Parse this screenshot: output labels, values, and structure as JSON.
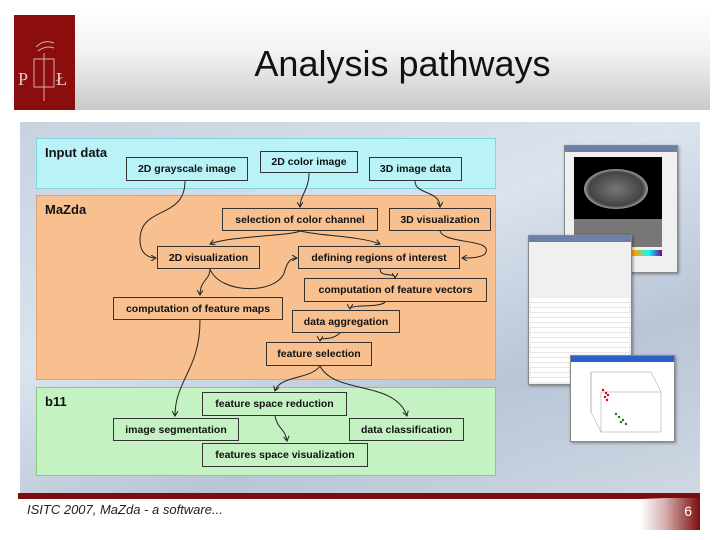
{
  "header": {
    "title": "Analysis pathways",
    "logo_text": "PŁ"
  },
  "diagram": {
    "zones": {
      "input": "Input data",
      "mazda": "MaZda",
      "b11": "b11"
    },
    "boxes": {
      "gray": "2D grayscale image",
      "color": "2D color image",
      "img3d": "3D image data",
      "selchan": "selection of color channel",
      "vis3d": "3D visualization",
      "vis2d": "2D visualization",
      "roi": "defining regions of interest",
      "fvec": "computation of feature vectors",
      "fmaps": "computation of feature maps",
      "agg": "data aggregation",
      "fsel": "feature selection",
      "fsr": "feature space reduction",
      "seg": "image segmentation",
      "cls": "data classification",
      "fsv": "features space visualization"
    },
    "colors": {
      "input": "#b9f3f7",
      "mazda": "#f8c08f",
      "b11": "#c5f2c2"
    }
  },
  "footer": {
    "text": "ISITC 2007, MaZda - a software...",
    "page": "6"
  }
}
